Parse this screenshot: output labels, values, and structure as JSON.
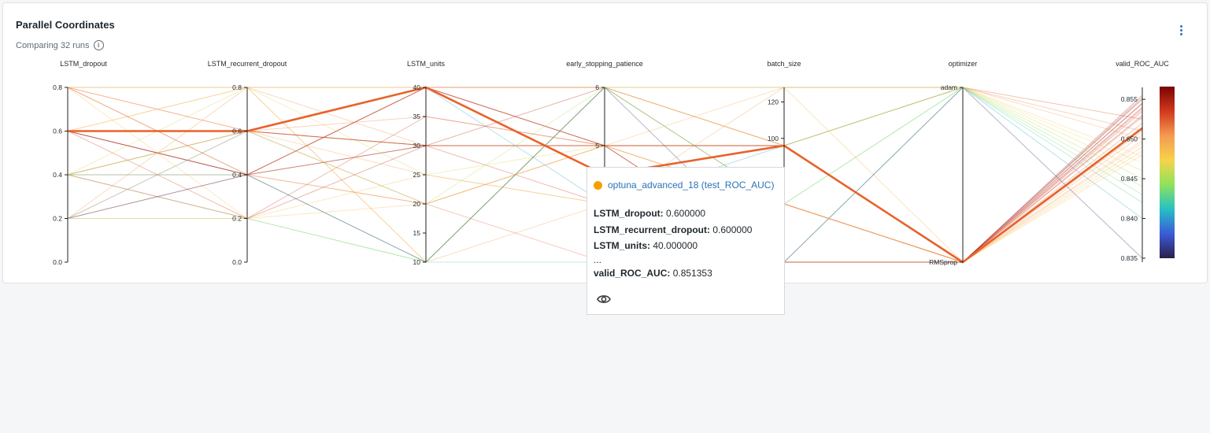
{
  "card": {
    "title": "Parallel Coordinates",
    "subtitle": "Comparing 32 runs"
  },
  "icons": {
    "info": "info-icon",
    "menu": "kebab-menu-icon",
    "view": "eye-icon"
  },
  "colors": {
    "highlight": "#e8622a",
    "tooltip_dot": "#f5a000",
    "link": "#2c72b5",
    "colorbar": [
      "#fde3c8",
      "#f7c28f",
      "#f49a52",
      "#e8622a",
      "#c23118",
      "#7a0403"
    ]
  },
  "chart_data": {
    "type": "parallel_coordinates",
    "axes": [
      {
        "name": "LSTM_dropout",
        "range": [
          0,
          0.8
        ],
        "ticks": [
          {
            "v": 0,
            "t": "0.0"
          },
          {
            "v": 0.2,
            "t": "0.2"
          },
          {
            "v": 0.4,
            "t": "0.4"
          },
          {
            "v": 0.6,
            "t": "0.6"
          },
          {
            "v": 0.8,
            "t": "0.8"
          }
        ]
      },
      {
        "name": "LSTM_recurrent_dropout",
        "range": [
          0,
          0.8
        ],
        "ticks": [
          {
            "v": 0,
            "t": "0.0"
          },
          {
            "v": 0.2,
            "t": "0.2"
          },
          {
            "v": 0.4,
            "t": "0.4"
          },
          {
            "v": 0.6,
            "t": "0.6"
          },
          {
            "v": 0.8,
            "t": "0.8"
          }
        ]
      },
      {
        "name": "LSTM_units",
        "range": [
          10,
          40
        ],
        "ticks": [
          {
            "v": 10,
            "t": "10"
          },
          {
            "v": 15,
            "t": "15"
          },
          {
            "v": 20,
            "t": "20"
          },
          {
            "v": 25,
            "t": "25"
          },
          {
            "v": 30,
            "t": "30"
          },
          {
            "v": 35,
            "t": "35"
          },
          {
            "v": 40,
            "t": "40"
          }
        ]
      },
      {
        "name": "early_stopping_patience",
        "range": [
          3,
          6
        ],
        "ticks": [
          {
            "v": 5,
            "t": "5"
          },
          {
            "v": 6,
            "t": "6"
          }
        ]
      },
      {
        "name": "batch_size",
        "range": [
          32,
          128
        ],
        "ticks": [
          {
            "v": 100,
            "t": "100"
          },
          {
            "v": 120,
            "t": "120"
          }
        ]
      },
      {
        "name": "optimizer",
        "categories": [
          "RMSprop",
          "adam"
        ],
        "ticks": [
          {
            "v": 0,
            "t": "RMSprop"
          },
          {
            "v": 1,
            "t": "adam"
          }
        ]
      },
      {
        "name": "valid_ROC_AUC",
        "range": [
          0.8345,
          0.8565
        ],
        "ticks": [
          {
            "v": 0.835,
            "t": "0.835"
          },
          {
            "v": 0.84,
            "t": "0.840"
          },
          {
            "v": 0.845,
            "t": "0.845"
          },
          {
            "v": 0.85,
            "t": "0.850"
          },
          {
            "v": 0.855,
            "t": "0.855"
          }
        ]
      }
    ],
    "highlight": {
      "values": [
        0.6,
        0.6,
        40,
        4.5,
        96,
        0,
        0.851353
      ]
    },
    "runs": [
      [
        0.8,
        0.8,
        40,
        6,
        128,
        1,
        0.8525
      ],
      [
        0.8,
        0.6,
        30,
        5,
        96,
        1,
        0.851
      ],
      [
        0.8,
        0.4,
        20,
        5,
        64,
        0,
        0.8495
      ],
      [
        0.8,
        0.2,
        25,
        4,
        32,
        0,
        0.848
      ],
      [
        0.8,
        0.8,
        10,
        6,
        96,
        1,
        0.847
      ],
      [
        0.6,
        0.6,
        30,
        5,
        96,
        0,
        0.855
      ],
      [
        0.6,
        0.4,
        40,
        6,
        64,
        0,
        0.854
      ],
      [
        0.6,
        0.2,
        35,
        5,
        32,
        0,
        0.853
      ],
      [
        0.6,
        0.8,
        10,
        4,
        128,
        1,
        0.85
      ],
      [
        0.6,
        0.4,
        30,
        5,
        96,
        0,
        0.8555
      ],
      [
        0.6,
        0.6,
        20,
        3,
        64,
        0,
        0.852
      ],
      [
        0.4,
        0.6,
        40,
        5,
        96,
        0,
        0.8545
      ],
      [
        0.4,
        0.4,
        30,
        4,
        32,
        0,
        0.8535
      ],
      [
        0.4,
        0.2,
        10,
        6,
        64,
        1,
        0.844
      ],
      [
        0.4,
        0.8,
        25,
        5,
        96,
        1,
        0.846
      ],
      [
        0.4,
        0.4,
        10,
        3,
        32,
        1,
        0.842
      ],
      [
        0.4,
        0.6,
        30,
        5,
        128,
        0,
        0.849
      ],
      [
        0.2,
        0.4,
        20,
        5,
        96,
        0,
        0.8515
      ],
      [
        0.2,
        0.2,
        10,
        6,
        64,
        1,
        0.843
      ],
      [
        0.2,
        0.8,
        30,
        5,
        32,
        0,
        0.8505
      ],
      [
        0.2,
        0.6,
        40,
        4,
        96,
        1,
        0.84
      ],
      [
        0.2,
        0.4,
        10,
        6,
        32,
        1,
        0.835
      ],
      [
        0.2,
        0.2,
        20,
        5,
        64,
        0,
        0.8485
      ],
      [
        0.6,
        0.6,
        30,
        6,
        96,
        0,
        0.8545
      ],
      [
        0.6,
        0.4,
        40,
        5,
        32,
        0,
        0.8552
      ],
      [
        0.8,
        0.6,
        35,
        5,
        64,
        0,
        0.851
      ],
      [
        0.4,
        0.2,
        30,
        5,
        96,
        0,
        0.8538
      ],
      [
        0.6,
        0.8,
        40,
        6,
        96,
        1,
        0.8478
      ],
      [
        0.2,
        0.6,
        25,
        4,
        64,
        0,
        0.8498
      ],
      [
        0.8,
        0.4,
        40,
        5,
        96,
        0,
        0.8528
      ],
      [
        0.4,
        0.6,
        20,
        6,
        128,
        1,
        0.845
      ]
    ]
  },
  "tooltip": {
    "run_name": "optuna_advanced_18 (test_ROC_AUC)",
    "rows": [
      {
        "key": "LSTM_dropout:",
        "value": "0.600000"
      },
      {
        "key": "LSTM_recurrent_dropout:",
        "value": "0.600000"
      },
      {
        "key": "LSTM_units:",
        "value": "40.000000"
      }
    ],
    "ellipsis": "...",
    "metric_key": "valid_ROC_AUC:",
    "metric_value": "0.851353"
  }
}
